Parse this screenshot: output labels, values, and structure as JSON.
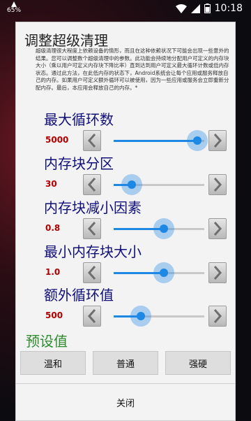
{
  "status_bar": {
    "battery_label": "65%",
    "time": "10:18"
  },
  "dialog": {
    "title": "调整超级清理",
    "description": "超级清理很大程度上依赖设备的情形，而且在这种依赖状况下可能会出现一些意外的结果。您可以调整数个超级清理中的参数。此功能会持续地分配用户可定义的内存块大小（乘以用户可定义内存块下降比率）直到达到用户可定义最大循环计数或低内存状态。通过此方法，在此低内存的状态下，Android系统会让每个应用或服务释放自己的内存。如果用户可定义额外循环可以被使用，因为一些应用或服务会立即重新分配内存。最后，本应用会释放自己的内存。*",
    "settings": [
      {
        "label": "最大循环数",
        "value": "5000",
        "level": 0.92
      },
      {
        "label": "内存块分区",
        "value": "30",
        "level": 0.2
      },
      {
        "label": "内存块减小因素",
        "value": "0.8",
        "level": 0.55
      },
      {
        "label": "最小内存块大小",
        "value": "1.0",
        "level": 0.55
      },
      {
        "label": "额外循环值",
        "value": "500",
        "level": 0.3
      }
    ],
    "preset_title": "预设值",
    "presets": [
      "温和",
      "普通",
      "强硬"
    ],
    "close_label": "关闭"
  },
  "colors": {
    "accent": "#1e88e5",
    "setting_label": "#10107a",
    "setting_value": "#b00000",
    "preset_title": "#2e8b2e"
  }
}
